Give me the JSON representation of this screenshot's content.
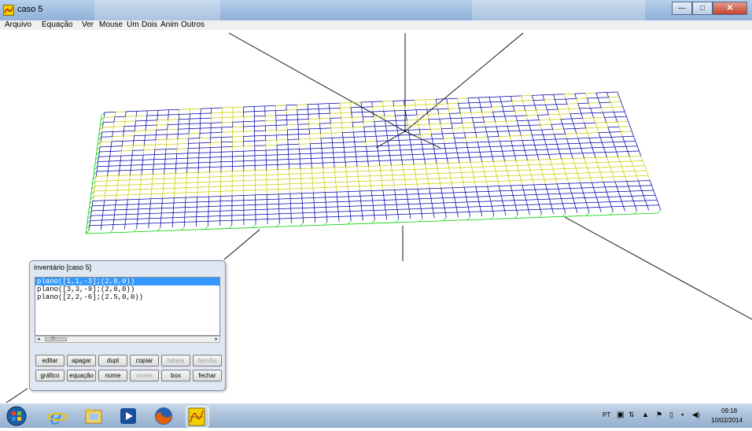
{
  "window": {
    "title": "caso 5",
    "controls": {
      "minimize_icon": "minimize-icon",
      "maximize_icon": "maximize-icon",
      "close_icon": "close-icon"
    }
  },
  "menu": {
    "items": [
      "Arquivo",
      "Equação",
      "Ver",
      "Mouse",
      "Um",
      "Dois",
      "Anim",
      "Outros"
    ]
  },
  "scene": {
    "colors": {
      "plane_1": "#0000aa",
      "plane_2": "#cccc00",
      "plane_3": "#00cc00",
      "axes": "#000000",
      "background": "#ffffff"
    }
  },
  "inventory": {
    "title": "inventário [caso 5]",
    "items": [
      "plano([1,1,-3];(2,0,0))",
      "plano([3,3,-9];(2,0,0))",
      "plano([2,2,-6];(2.5,0,0))"
    ],
    "selected_index": 0,
    "scroll_marker": "III",
    "buttons_row1": [
      "editar",
      "apagar",
      "dupl",
      "copiar",
      "tabela",
      "família"
    ],
    "buttons_row2": [
      "gráfico",
      "equação",
      "nome",
      "níveis",
      "box",
      "fechar"
    ],
    "disabled_buttons": [
      "tabela",
      "família",
      "níveis"
    ]
  },
  "taskbar": {
    "apps": [
      "start-orb-icon",
      "internet-explorer-icon",
      "file-explorer-icon",
      "media-player-icon",
      "firefox-icon",
      "winplot-icon"
    ],
    "tray": {
      "language": "PT",
      "time": "09:18",
      "date": "10/02/2014"
    }
  }
}
